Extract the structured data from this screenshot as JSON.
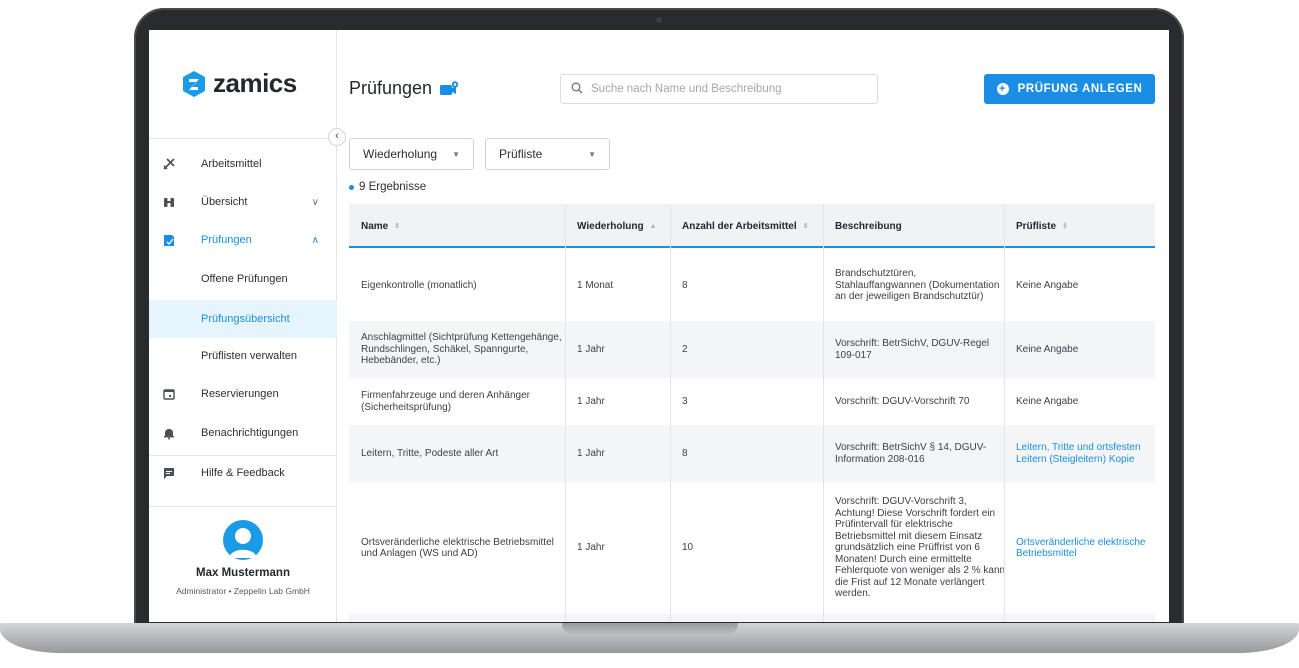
{
  "brand": {
    "name": "zamics",
    "accent": "#1a8ee5"
  },
  "sidebar": {
    "items": [
      {
        "label": "Arbeitsmittel",
        "icon": "tools-icon"
      },
      {
        "label": "Übersicht",
        "icon": "binoculars-icon",
        "chevron": "∨"
      },
      {
        "label": "Prüfungen",
        "icon": "clipboard-icon",
        "chevron": "∧"
      },
      {
        "label": "Offene Prüfungen"
      },
      {
        "label": "Prüfungsübersicht"
      },
      {
        "label": "Prüflisten verwalten"
      },
      {
        "label": "Reservierungen",
        "icon": "calendar-icon"
      },
      {
        "label": "Benachrichtigungen",
        "icon": "bell-icon"
      },
      {
        "label": "Hilfe & Feedback",
        "icon": "chat-icon"
      }
    ],
    "collapse_glyph": "‹"
  },
  "user": {
    "name": "Max Mustermann",
    "role": "Administrator • Zeppelin Lab GmbH"
  },
  "header": {
    "title": "Prüfungen",
    "search_placeholder": "Suche nach Name und Beschreibung",
    "add_button": "PRÜFUNG ANLEGEN"
  },
  "filters": {
    "wiederholung": "Wiederholung",
    "pruefliste": "Prüfliste"
  },
  "result_count": "9 Ergebnisse",
  "table": {
    "columns": [
      {
        "label": "Name",
        "sort": "⇕"
      },
      {
        "label": "Wiederholung",
        "sort": "▲"
      },
      {
        "label": "Anzahl der Arbeitsmittel",
        "sort": "⇕"
      },
      {
        "label": "Beschreibung",
        "sort": ""
      },
      {
        "label": "Prüfliste",
        "sort": "⇕"
      }
    ],
    "rows": [
      {
        "name": "Eigenkontrolle (monatlich)",
        "wiederholung": "1 Monat",
        "anzahl": "8",
        "beschreibung": "Brandschutztüren, Stahlauffangwannen (Dokumentation an der jeweiligen Brandschutztür)",
        "pruefliste": "Keine Angabe"
      },
      {
        "name": "Anschlagmittel (Sichtprüfung Kettengehänge, Rundschlingen, Schäkel, Spanngurte, Hebebänder, etc.)",
        "wiederholung": "1 Jahr",
        "anzahl": "2",
        "beschreibung": "Vorschrift: BetrSichV, DGUV-Regel 109-017",
        "pruefliste": "Keine Angabe"
      },
      {
        "name": "Firmenfahrzeuge und deren Anhänger (Sicherheitsprüfung)",
        "wiederholung": "1 Jahr",
        "anzahl": "3",
        "beschreibung": "Vorschrift: DGUV-Vorschrift 70",
        "pruefliste": "Keine Angabe"
      },
      {
        "name": "Leitern, Tritte, Podeste aller Art",
        "wiederholung": "1 Jahr",
        "anzahl": "8",
        "beschreibung": "Vorschrift: BetrSichV § 14, DGUV-Information 208-016",
        "pruefliste": "Leitern, Tritte und ortsfesten Leitern (Steigleitern) Kopie"
      },
      {
        "name": "Ortsveränderliche elektrische Betriebsmittel und Anlagen (WS und AD)",
        "wiederholung": "1 Jahr",
        "anzahl": "10",
        "beschreibung": "Vorschrift: DGUV-Vorschrift 3, Achtung! Diese Vorschrift fordert ein Prüfintervall für elektrische Betriebsmittel mit diesem Einsatz grundsätzlich eine Prüffrist von 6 Monaten! Durch eine ermittelte Fehlerquote von weniger als 2 % kann die Frist auf 12 Monate verlängert werden.",
        "pruefliste": "Ortsveränderliche elektrische Betriebsmittel"
      }
    ]
  }
}
